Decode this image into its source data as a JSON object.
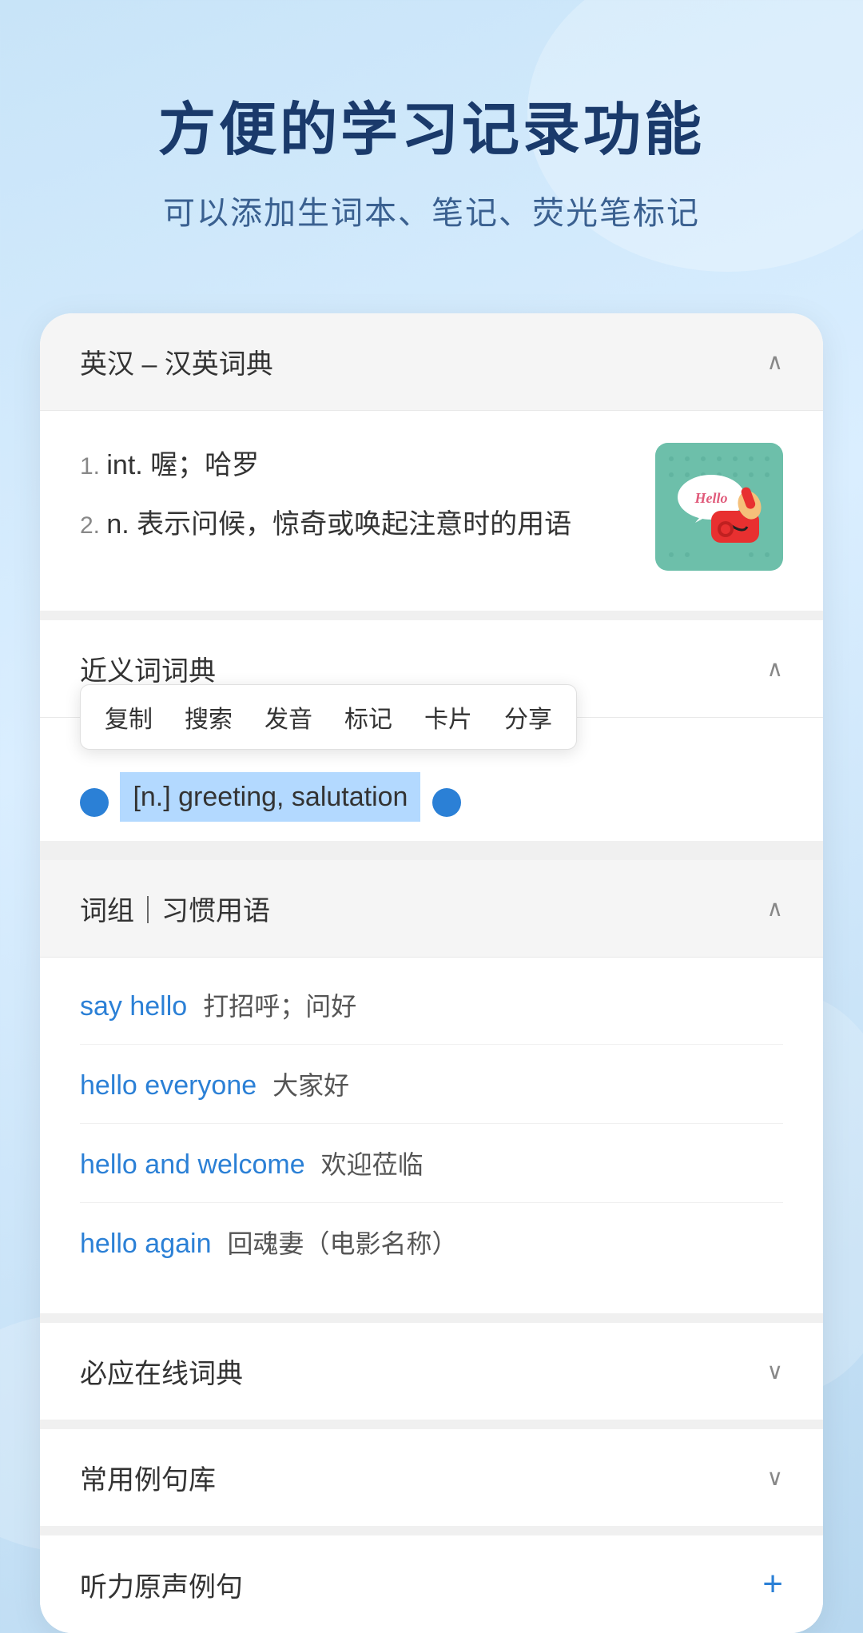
{
  "header": {
    "title": "方便的学习记录功能",
    "subtitle": "可以添加生词本、笔记、荧光笔标记"
  },
  "dictionary_section": {
    "title": "英汉 – 汉英词典",
    "chevron": "∧",
    "definitions": [
      {
        "num": "1.",
        "pos": "int.",
        "meaning": "喔；哈罗"
      },
      {
        "num": "2.",
        "pos": "n.",
        "meaning": "表示问候，惊奇或唤起注意时的用语"
      }
    ]
  },
  "synonym_section": {
    "title": "近义词词典",
    "chevron": "∧",
    "context_menu": [
      "复制",
      "搜索",
      "发音",
      "标记",
      "卡片",
      "分享"
    ],
    "selected_text": "[n.] greeting, salutation"
  },
  "phrases_section": {
    "title": "词组｜习惯用语",
    "chevron": "∧",
    "items": [
      {
        "en": "say hello",
        "zh": "打招呼；问好"
      },
      {
        "en": "hello everyone",
        "zh": "大家好"
      },
      {
        "en": "hello and welcome",
        "zh": "欢迎莅临"
      },
      {
        "en": "hello again",
        "zh": "回魂妻（电影名称）"
      }
    ]
  },
  "collapsed_sections": [
    {
      "title": "必应在线词典",
      "icon": "chevron-down",
      "extra": ""
    },
    {
      "title": "常用例句库",
      "icon": "chevron-down",
      "extra": ""
    },
    {
      "title": "听力原声例句",
      "icon": "plus",
      "extra": "+"
    }
  ]
}
